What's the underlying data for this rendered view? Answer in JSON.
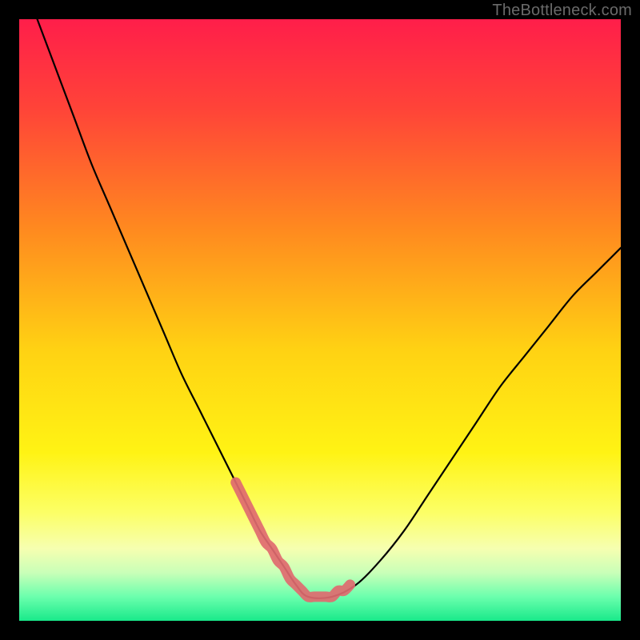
{
  "watermark": "TheBottleneck.com",
  "colors": {
    "background": "#000000",
    "gradient_stops": [
      {
        "offset": 0.0,
        "color": "#ff1e4a"
      },
      {
        "offset": 0.15,
        "color": "#ff4438"
      },
      {
        "offset": 0.35,
        "color": "#ff8a1f"
      },
      {
        "offset": 0.55,
        "color": "#ffd213"
      },
      {
        "offset": 0.72,
        "color": "#fff314"
      },
      {
        "offset": 0.82,
        "color": "#fcff66"
      },
      {
        "offset": 0.88,
        "color": "#f6ffb0"
      },
      {
        "offset": 0.92,
        "color": "#c9ffb8"
      },
      {
        "offset": 0.96,
        "color": "#6bffad"
      },
      {
        "offset": 1.0,
        "color": "#19e98a"
      }
    ],
    "curve": "#000000",
    "highlight": "#e06a6f"
  },
  "chart_data": {
    "type": "line",
    "title": "",
    "xlabel": "",
    "ylabel": "",
    "xlim": [
      0,
      100
    ],
    "ylim": [
      0,
      100
    ],
    "grid": false,
    "legend": false,
    "series": [
      {
        "name": "bottleneck-curve",
        "x": [
          3,
          6,
          9,
          12,
          15,
          18,
          21,
          24,
          27,
          30,
          33,
          36,
          38,
          40,
          42,
          44,
          46,
          48,
          52,
          56,
          60,
          64,
          68,
          72,
          76,
          80,
          84,
          88,
          92,
          96,
          100
        ],
        "values": [
          100,
          92,
          84,
          76,
          69,
          62,
          55,
          48,
          41,
          35,
          29,
          23,
          19,
          15,
          12,
          9,
          6,
          4,
          4,
          6,
          10,
          15,
          21,
          27,
          33,
          39,
          44,
          49,
          54,
          58,
          62
        ]
      },
      {
        "name": "optimal-band",
        "x": [
          36,
          37,
          38,
          39,
          40,
          41,
          42,
          43,
          44,
          45,
          46,
          47,
          48,
          49,
          50,
          51,
          52,
          53,
          54,
          55
        ],
        "values": [
          23,
          21,
          19,
          17,
          15,
          13,
          12,
          10,
          9,
          7,
          6,
          5,
          4,
          4,
          4,
          4,
          4,
          5,
          5,
          6
        ]
      }
    ],
    "annotations": []
  }
}
